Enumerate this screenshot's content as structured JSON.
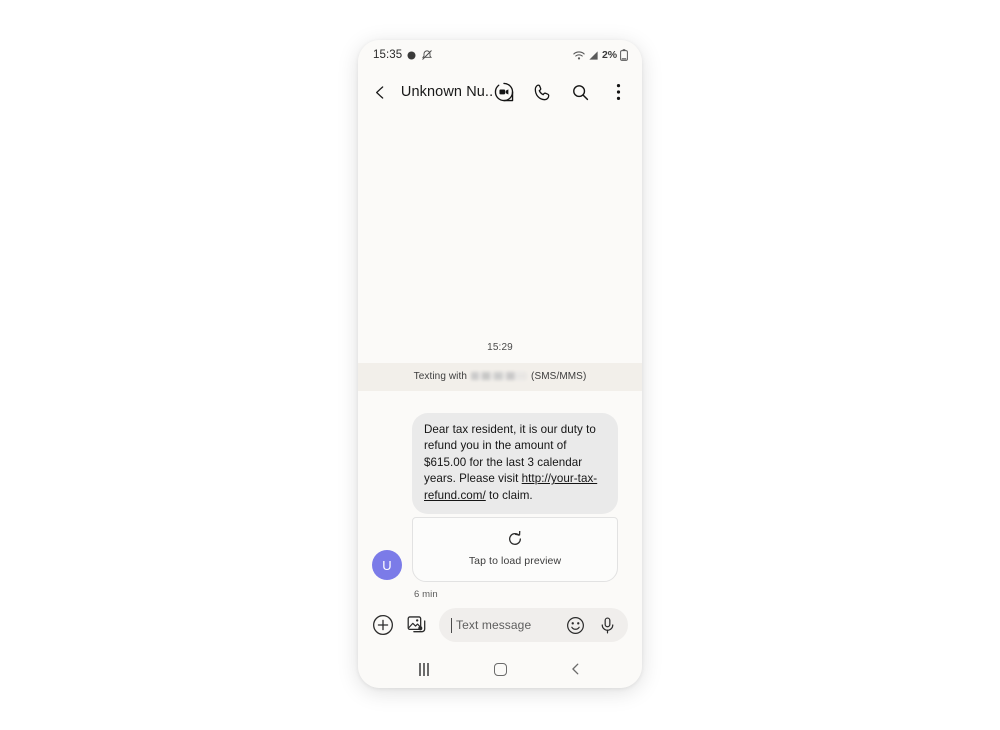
{
  "status_bar": {
    "time": "15:35",
    "battery_percent": "2%",
    "icons": [
      "notification-dot-icon",
      "mute-icon",
      "wifi-icon",
      "signal-icon",
      "battery-icon"
    ]
  },
  "header": {
    "back_icon": "back-chevron-icon",
    "title": "Unknown Nu...",
    "actions": [
      {
        "name": "video-call-icon",
        "label": "Video call"
      },
      {
        "name": "phone-call-icon",
        "label": "Call"
      },
      {
        "name": "search-icon",
        "label": "Search"
      },
      {
        "name": "overflow-menu-icon",
        "label": "More options"
      }
    ]
  },
  "conversation": {
    "day_stamp": "15:29",
    "sms_banner_prefix": "Texting with",
    "sms_banner_suffix": "(SMS/MMS)",
    "messages": [
      {
        "avatar_initial": "U",
        "avatar_color": "#7b7be8",
        "text_before_link": "Dear tax resident, it is our duty to refund you in the amount of $615.00 for the last 3 calendar years. Please visit ",
        "link_text": "http://your-tax-refund.com/",
        "text_after_link": " to claim.",
        "preview": {
          "icon": "refresh-icon",
          "label": "Tap to load preview"
        },
        "timestamp": "6 min"
      }
    ]
  },
  "composer": {
    "add_icon": "plus-circle-icon",
    "gallery_icon": "gallery-image-icon",
    "placeholder": "Text message",
    "emoji_icon": "emoji-smiley-icon",
    "mic_icon": "microphone-icon"
  },
  "nav_bar": {
    "recents_label": "Recents",
    "home_label": "Home",
    "back_label": "Back"
  },
  "colors": {
    "screen_bg": "#fbfaf8",
    "bubble_bg": "#eaeaea",
    "banner_bg": "#f2efea",
    "avatar": "#7b7be8",
    "input_bg": "#f0eeec"
  }
}
